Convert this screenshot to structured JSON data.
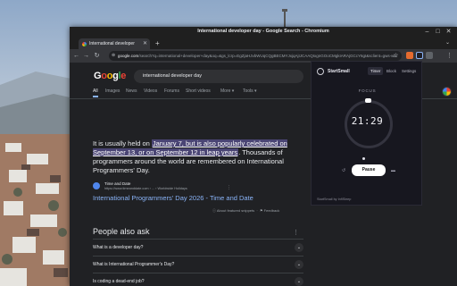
{
  "window": {
    "title": "International developer day - Google Search - Chromium"
  },
  "tabs": [
    {
      "label": "International developer"
    }
  ],
  "toolbar": {
    "url_host": "google.com",
    "url_path": "/search?q=international+developer+day&oq=&gs_lcrp=EgZjaHJvbWUqCQgBECMYJxjqAjIJCAAQIxgnGOoCMgkIARAjGCcY6gI&sclient=gws-wiz"
  },
  "search": {
    "logo": "Google",
    "query": "international developer day",
    "tabs": [
      "All",
      "Images",
      "News",
      "Videos",
      "Forums",
      "Short videos",
      "More ▾",
      "Tools ▾"
    ]
  },
  "snippet": {
    "pre": "It is usually held on ",
    "hl1": "January 7, but is also popularly celebrated on September 13, or on September 12 in leap years",
    "post": ". Thousands of programmers around the world are remembered on International Programmers' Day."
  },
  "result": {
    "site_name": "Time and Date",
    "site_url": "https://www.timeanddate.com › ... › Worldwide Holidays",
    "title": "International Programmers' Day 2026 - Time and Date"
  },
  "featured": {
    "about": "About featured snippets",
    "feedback": "Feedback"
  },
  "people_also_ask": {
    "heading": "People also ask",
    "questions": [
      "What is a developer day?",
      "What is International Programmer's Day?",
      "Is coding a dead-end job?"
    ]
  },
  "popup": {
    "app_name": "StartSmall",
    "tabs": [
      "Timer",
      "Block",
      "Settings"
    ],
    "mode_label": "FOCUS",
    "time": "21:29",
    "pause_label": "Pause",
    "footer": "StartSmall by InfiSleep"
  },
  "colors": {
    "accent": "#8ab4f8",
    "highlight": "#4a4574",
    "page_bg": "#202124"
  }
}
